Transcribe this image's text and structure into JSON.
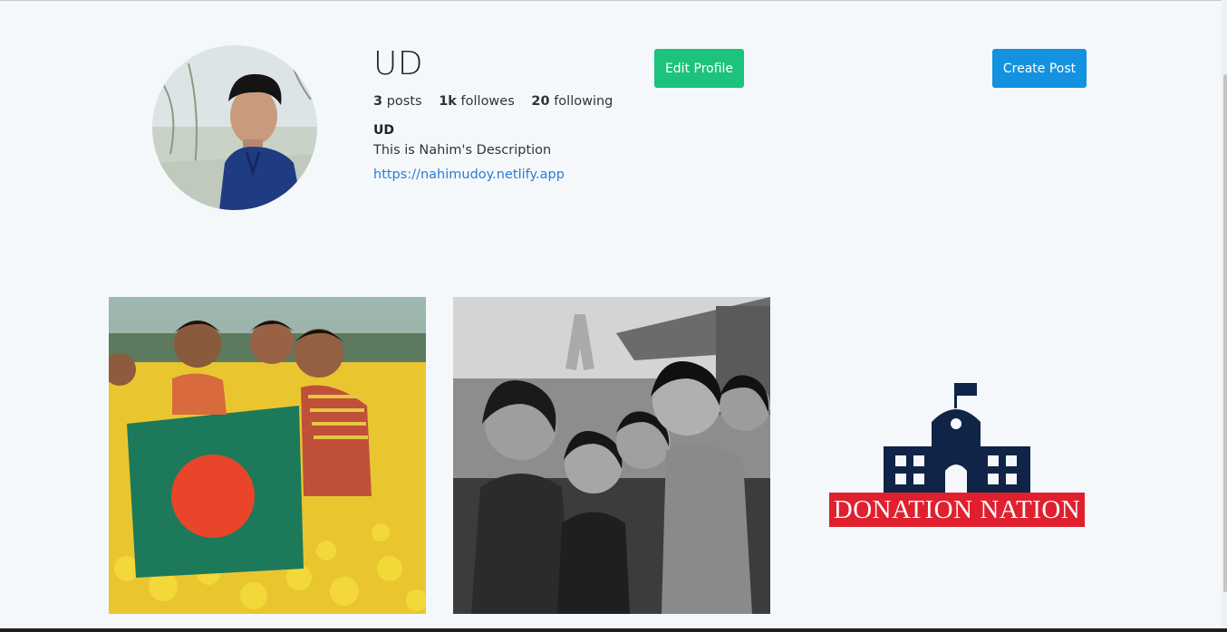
{
  "profile": {
    "username": "UD",
    "posts_count": "3",
    "posts_label": "posts",
    "followers_count": "1k",
    "followers_label": "followes",
    "following_count": "20",
    "following_label": "following",
    "full_name": "UD",
    "description": "This is Nahim's Description",
    "website": "https://nahimudoy.netlify.app"
  },
  "actions": {
    "edit_profile": "Edit Profile",
    "create_post": "Create Post"
  },
  "posts": [
    {
      "kind": "photo-children-flag"
    },
    {
      "kind": "photo-girls-bw"
    },
    {
      "kind": "logo",
      "logo_text": "DONATION NATION"
    }
  ],
  "colors": {
    "edit_button": "#1cc37c",
    "create_button": "#1492e0",
    "link": "#2a7bd6",
    "logo_navy": "#0f2446",
    "logo_red": "#e0202e"
  }
}
